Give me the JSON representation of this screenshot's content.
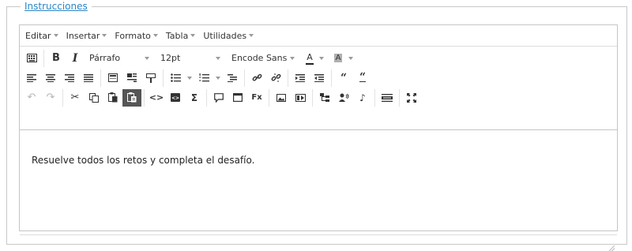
{
  "legend": "Instrucciones",
  "menubar": {
    "items": [
      {
        "label": "Editar"
      },
      {
        "label": "Insertar"
      },
      {
        "label": "Formato"
      },
      {
        "label": "Tabla"
      },
      {
        "label": "Utilidades"
      }
    ]
  },
  "toolbar": {
    "format_select": "Párrafo",
    "size_select": "12pt",
    "font_select": "Encode Sans",
    "text_color_letter": "A",
    "bg_color_letter": "A"
  },
  "content": {
    "text": "Resuelve todos los retos y completa el desafío."
  },
  "icons": {
    "row1": [
      "keyboard-icon",
      "bold-icon",
      "italic-icon"
    ],
    "row2": [
      "align-left-icon",
      "align-center-icon",
      "align-right-icon",
      "align-justify-icon",
      "table-icon",
      "image-wrap-icon",
      "format-painter-icon",
      "bullet-list-icon",
      "numbered-list-icon",
      "outdent-icon",
      "link-icon",
      "unlink-icon",
      "indent-icon",
      "outdent-block-icon",
      "blockquote-icon",
      "quote-icon"
    ],
    "row3": [
      "undo-icon",
      "redo-icon",
      "cut-icon",
      "copy-icon",
      "paste-icon",
      "paste-text-icon",
      "code-icon",
      "source-code-icon",
      "sigma-icon",
      "comment-icon",
      "fullscreen-box-icon",
      "clear-format-icon",
      "image-icon",
      "media-icon",
      "tree-icon",
      "speaker-icon",
      "music-icon",
      "html-icon",
      "expand-icon"
    ]
  },
  "colors": {
    "legend": "#2a86c8",
    "active_button": "#555555",
    "border": "#c5c5c5"
  }
}
